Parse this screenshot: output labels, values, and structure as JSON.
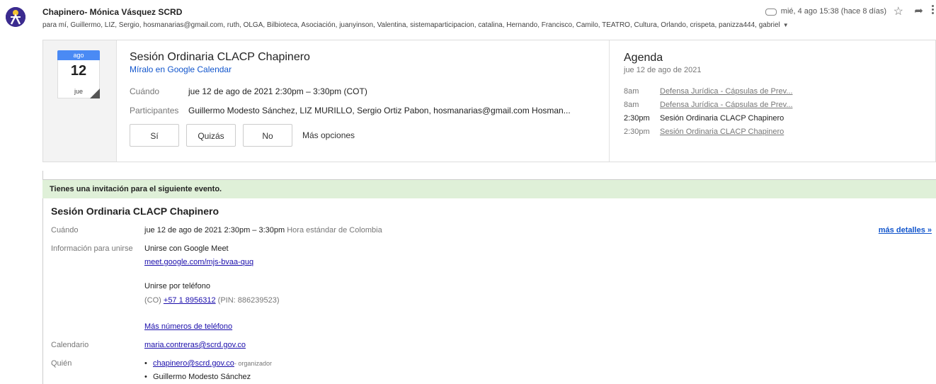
{
  "header": {
    "sender": "Chapinero- Mónica Vásquez SCRD",
    "recipients": "para mí, Guillermo, LIZ, Sergio, hosmanarias@gmail.com, ruth, OLGA, Bilbioteca, Asociación, juanyinson, Valentina, sistemaparticipacion, catalina, Hernando, Francisco, Camilo, TEATRO, Cultura, Orlando, crispeta, panizza444, gabriel",
    "date": "mié, 4 ago 15:38 (hace 8 días)"
  },
  "card": {
    "month": "ago",
    "day": "12",
    "weekday": "jue",
    "title": "Sesión Ordinaria CLACP Chapinero",
    "gcal_link": "Míralo en Google Calendar",
    "when_label": "Cuándo",
    "when_value": "jue 12 de ago de 2021 2:30pm – 3:30pm (COT)",
    "participants_label": "Participantes",
    "participants_value": "Guillermo Modesto Sánchez, LIZ MURILLO, Sergio Ortiz Pabon, hosmanarias@gmail.com Hosman...",
    "buttons": {
      "yes": "Sí",
      "maybe": "Quizás",
      "no": "No",
      "more": "Más opciones"
    }
  },
  "agenda": {
    "title": "Agenda",
    "date": "jue 12 de ago de 2021",
    "items": [
      {
        "time": "8am",
        "text": "Defensa Jurídica - Cápsulas de Prev..."
      },
      {
        "time": "8am",
        "text": "Defensa Jurídica - Cápsulas de Prev..."
      },
      {
        "time": "2:30pm",
        "text": "Sesión Ordinaria CLACP Chapinero"
      },
      {
        "time": "2:30pm",
        "text": "Sesión Ordinaria CLACP Chapinero"
      }
    ]
  },
  "details": {
    "banner": "Tienes una invitación para el siguiente evento.",
    "title": "Sesión Ordinaria CLACP Chapinero",
    "when_label": "Cuándo",
    "when_value": "jue 12 de ago de 2021 2:30pm – 3:30pm",
    "when_tz": "Hora estándar de Colombia",
    "more_details": "más detalles »",
    "join_label": "Información para unirse",
    "meet_label": "Unirse con Google Meet",
    "meet_link": "meet.google.com/mjs-bvaa-quq",
    "phone_label": "Unirse por teléfono",
    "phone_prefix": "(CO)",
    "phone_number": "+57 1 8956312",
    "phone_pin": "(PIN: 886239523)",
    "more_numbers": "Más números de teléfono",
    "calendar_label": "Calendario",
    "calendar_value": "maria.contreras@scrd.gov.co",
    "who_label": "Quién",
    "who": [
      {
        "name": "chapinero@scrd.gov.co",
        "role": "- organizador"
      },
      {
        "name": "Guillermo Modesto Sánchez",
        "role": ""
      }
    ]
  }
}
